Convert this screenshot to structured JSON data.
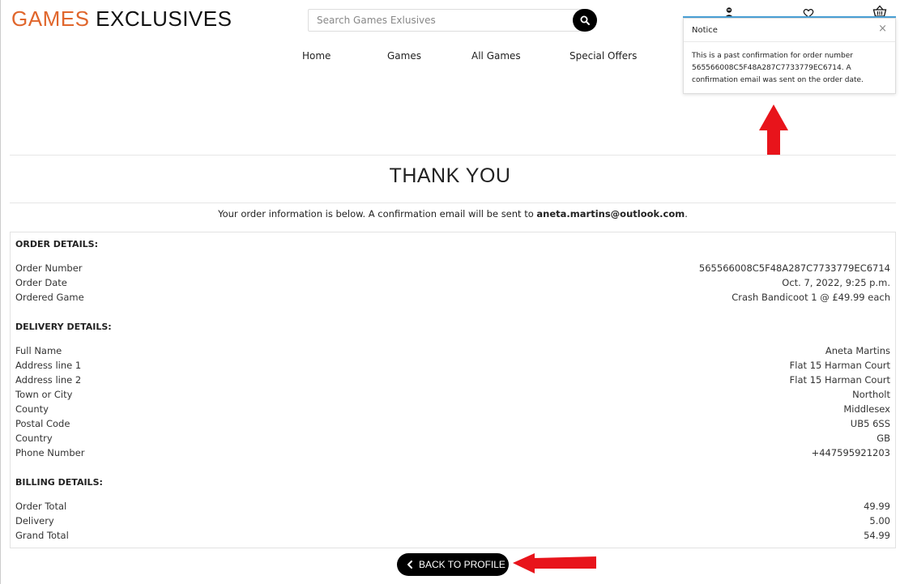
{
  "header": {
    "logo_brand": "GAMES",
    "logo_rest": "EXCLUSIVES",
    "search_placeholder": "Search Games Exlusives",
    "icons": [
      "account-icon",
      "heart-icon",
      "basket-icon"
    ]
  },
  "nav": [
    "Home",
    "Games",
    "All Games",
    "Special Offers"
  ],
  "toast": {
    "title": "Notice",
    "close": "×",
    "message": "This is a past confirmation for order number 565566008C5F48A287C7733779EC6714. A confirmation email was sent on the order date."
  },
  "page": {
    "title": "THANK YOU",
    "info_prefix": "Your order information is below. A confirmation email will be sent to ",
    "email": "aneta.martins@outlook.com",
    "info_suffix": "."
  },
  "order": {
    "heading": "ORDER DETAILS:",
    "rows": [
      {
        "label": "Order Number",
        "value": "565566008C5F48A287C7733779EC6714"
      },
      {
        "label": "Order Date",
        "value": "Oct. 7, 2022, 9:25 p.m."
      },
      {
        "label": "Ordered Game",
        "value": "Crash Bandicoot 1 @ £49.99 each"
      }
    ]
  },
  "delivery": {
    "heading": "DELIVERY DETAILS:",
    "rows": [
      {
        "label": "Full Name",
        "value": "Aneta Martins"
      },
      {
        "label": "Address line 1",
        "value": "Flat 15 Harman Court"
      },
      {
        "label": "Address line 2",
        "value": "Flat 15 Harman Court"
      },
      {
        "label": "Town or City",
        "value": "Northolt"
      },
      {
        "label": "County",
        "value": "Middlesex"
      },
      {
        "label": "Postal Code",
        "value": "UB5 6SS"
      },
      {
        "label": "Country",
        "value": "GB"
      },
      {
        "label": "Phone Number",
        "value": "+447595921203"
      }
    ]
  },
  "billing": {
    "heading": "BILLING DETAILS:",
    "rows": [
      {
        "label": "Order Total",
        "value": "49.99"
      },
      {
        "label": "Delivery",
        "value": "5.00"
      },
      {
        "label": "Grand Total",
        "value": "54.99"
      }
    ]
  },
  "actions": {
    "back_label": "BACK TO PROFILE"
  },
  "colors": {
    "brand": "#e0662c",
    "accent_underline": "#4ba3d8",
    "annotation_arrow": "#e8141b"
  }
}
